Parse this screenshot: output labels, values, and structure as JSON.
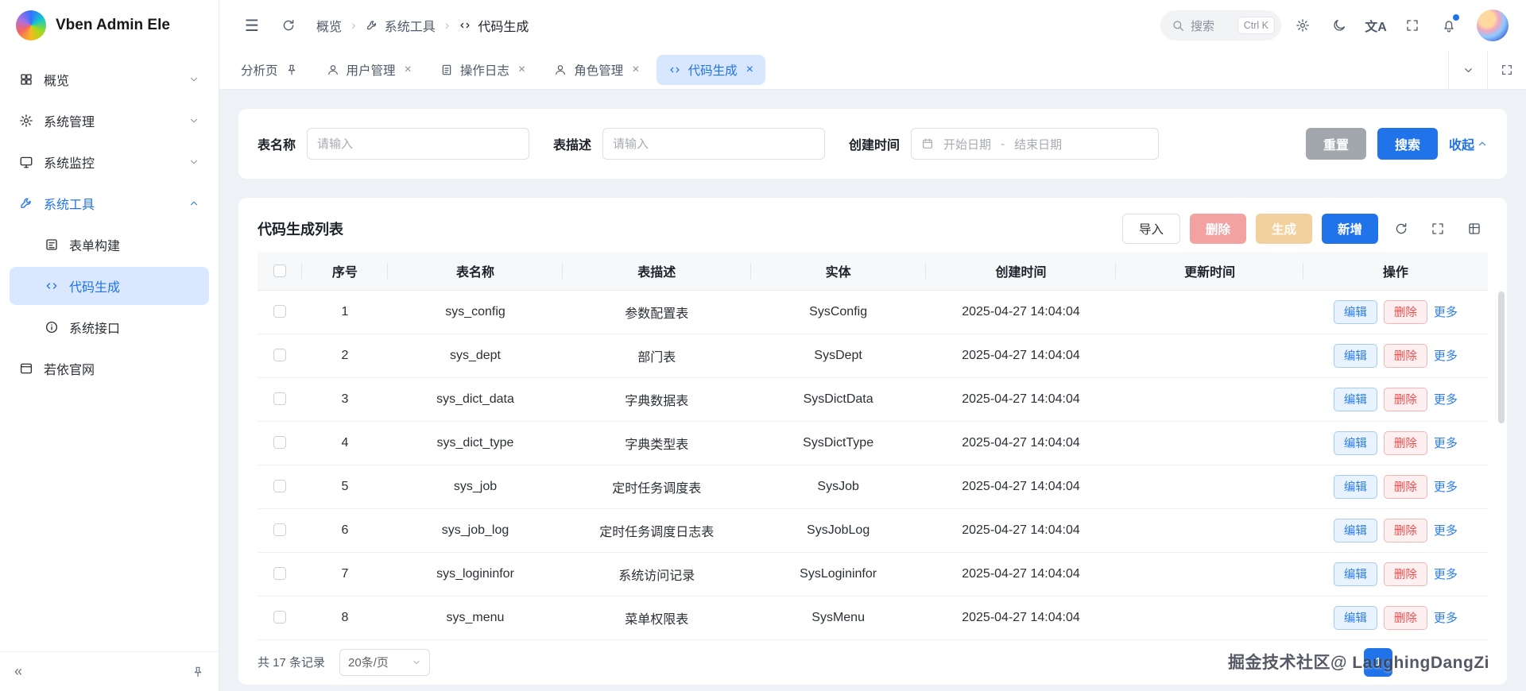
{
  "app": {
    "title": "Vben Admin Ele"
  },
  "icons": {
    "hamburger": "☰",
    "crumb_sep": "›",
    "close": "×",
    "translate": "文A",
    "collapse": "«",
    "range_sep": "-"
  },
  "sidebar": {
    "items": [
      {
        "label": "概览"
      },
      {
        "label": "系统管理"
      },
      {
        "label": "系统监控"
      },
      {
        "label": "系统工具",
        "children": [
          {
            "label": "表单构建"
          },
          {
            "label": "代码生成"
          },
          {
            "label": "系统接口"
          }
        ]
      },
      {
        "label": "若依官网"
      }
    ]
  },
  "header": {
    "breadcrumb": [
      {
        "label": "概览"
      },
      {
        "label": "系统工具"
      },
      {
        "label": "代码生成"
      }
    ],
    "search": {
      "label": "搜索",
      "shortcut": "Ctrl K"
    }
  },
  "tabs": [
    {
      "label": "分析页"
    },
    {
      "label": "用户管理"
    },
    {
      "label": "操作日志"
    },
    {
      "label": "角色管理"
    },
    {
      "label": "代码生成"
    }
  ],
  "filter": {
    "fields": [
      {
        "label": "表名称",
        "placeholder": "请输入"
      },
      {
        "label": "表描述",
        "placeholder": "请输入"
      },
      {
        "label": "创建时间",
        "start": "开始日期",
        "end": "结束日期"
      }
    ],
    "reset": "重置",
    "search": "搜索",
    "collapse": "收起"
  },
  "list": {
    "title": "代码生成列表",
    "toolbar": {
      "import": "导入",
      "delete": "删除",
      "generate": "生成",
      "add": "新增"
    },
    "columns": [
      "序号",
      "表名称",
      "表描述",
      "实体",
      "创建时间",
      "更新时间",
      "操作"
    ],
    "row_actions": {
      "edit": "编辑",
      "delete": "删除",
      "more": "更多"
    },
    "rows": [
      {
        "no": "1",
        "name": "sys_config",
        "desc": "参数配置表",
        "entity": "SysConfig",
        "created": "2025-04-27 14:04:04",
        "updated": ""
      },
      {
        "no": "2",
        "name": "sys_dept",
        "desc": "部门表",
        "entity": "SysDept",
        "created": "2025-04-27 14:04:04",
        "updated": ""
      },
      {
        "no": "3",
        "name": "sys_dict_data",
        "desc": "字典数据表",
        "entity": "SysDictData",
        "created": "2025-04-27 14:04:04",
        "updated": ""
      },
      {
        "no": "4",
        "name": "sys_dict_type",
        "desc": "字典类型表",
        "entity": "SysDictType",
        "created": "2025-04-27 14:04:04",
        "updated": ""
      },
      {
        "no": "5",
        "name": "sys_job",
        "desc": "定时任务调度表",
        "entity": "SysJob",
        "created": "2025-04-27 14:04:04",
        "updated": ""
      },
      {
        "no": "6",
        "name": "sys_job_log",
        "desc": "定时任务调度日志表",
        "entity": "SysJobLog",
        "created": "2025-04-27 14:04:04",
        "updated": ""
      },
      {
        "no": "7",
        "name": "sys_logininfor",
        "desc": "系统访问记录",
        "entity": "SysLogininfor",
        "created": "2025-04-27 14:04:04",
        "updated": ""
      },
      {
        "no": "8",
        "name": "sys_menu",
        "desc": "菜单权限表",
        "entity": "SysMenu",
        "created": "2025-04-27 14:04:04",
        "updated": ""
      }
    ],
    "footer": {
      "total": "共 17 条记录",
      "page_size": "20条/页",
      "page": "1"
    }
  },
  "watermark": "掘金技术社区@ LaughingDangZi",
  "colors": {
    "primary": "#2173ea",
    "sidebar_active_bg": "#d9e8ff",
    "tab_active_bg": "#d8e7fe",
    "danger_disabled": "#f3a2a2",
    "warning_disabled": "#f3d19e",
    "edit_btn_text": "#2b7cf0",
    "delete_btn_text": "#f04e4e",
    "content_bg": "#eef1f5"
  }
}
